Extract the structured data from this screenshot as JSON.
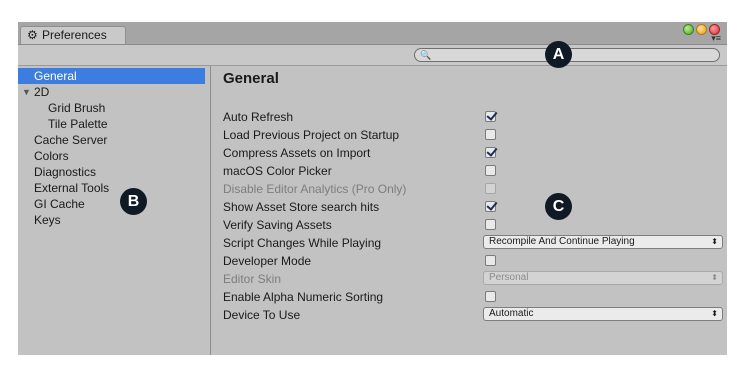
{
  "window": {
    "tab_title": "Preferences",
    "tab_icon": "gear-icon",
    "search": {
      "value": "",
      "placeholder": ""
    }
  },
  "sidebar": {
    "items": [
      {
        "label": "General",
        "selected": true
      },
      {
        "label": "2D",
        "expanded": true
      },
      {
        "label": "Grid Brush",
        "child": true
      },
      {
        "label": "Tile Palette",
        "child": true
      },
      {
        "label": "Cache Server"
      },
      {
        "label": "Colors"
      },
      {
        "label": "Diagnostics"
      },
      {
        "label": "External Tools"
      },
      {
        "label": "GI Cache"
      },
      {
        "label": "Keys"
      }
    ]
  },
  "main": {
    "heading": "General",
    "settings": [
      {
        "label": "Auto Refresh",
        "type": "checkbox",
        "checked": true
      },
      {
        "label": "Load Previous Project on Startup",
        "type": "checkbox",
        "checked": false
      },
      {
        "label": "Compress Assets on Import",
        "type": "checkbox",
        "checked": true
      },
      {
        "label": "macOS Color Picker",
        "type": "checkbox",
        "checked": false
      },
      {
        "label": "Disable Editor Analytics (Pro Only)",
        "type": "checkbox",
        "checked": false,
        "disabled": true
      },
      {
        "label": "Show Asset Store search hits",
        "type": "checkbox",
        "checked": true
      },
      {
        "label": "Verify Saving Assets",
        "type": "checkbox",
        "checked": false
      },
      {
        "label": "Script Changes While Playing",
        "type": "dropdown",
        "value": "Recompile And Continue Playing"
      },
      {
        "label": "Developer Mode",
        "type": "checkbox",
        "checked": false
      },
      {
        "label": "Editor Skin",
        "type": "dropdown",
        "value": "Personal",
        "disabled": true
      },
      {
        "label": "Enable Alpha Numeric Sorting",
        "type": "checkbox",
        "checked": false
      },
      {
        "label": "Device To Use",
        "type": "dropdown",
        "value": "Automatic"
      }
    ]
  },
  "callouts": {
    "a": "A",
    "b": "B",
    "c": "C"
  },
  "colors": {
    "selection": "#3e7de0",
    "panel": "#c2c2c2",
    "badge": "#101a24"
  }
}
